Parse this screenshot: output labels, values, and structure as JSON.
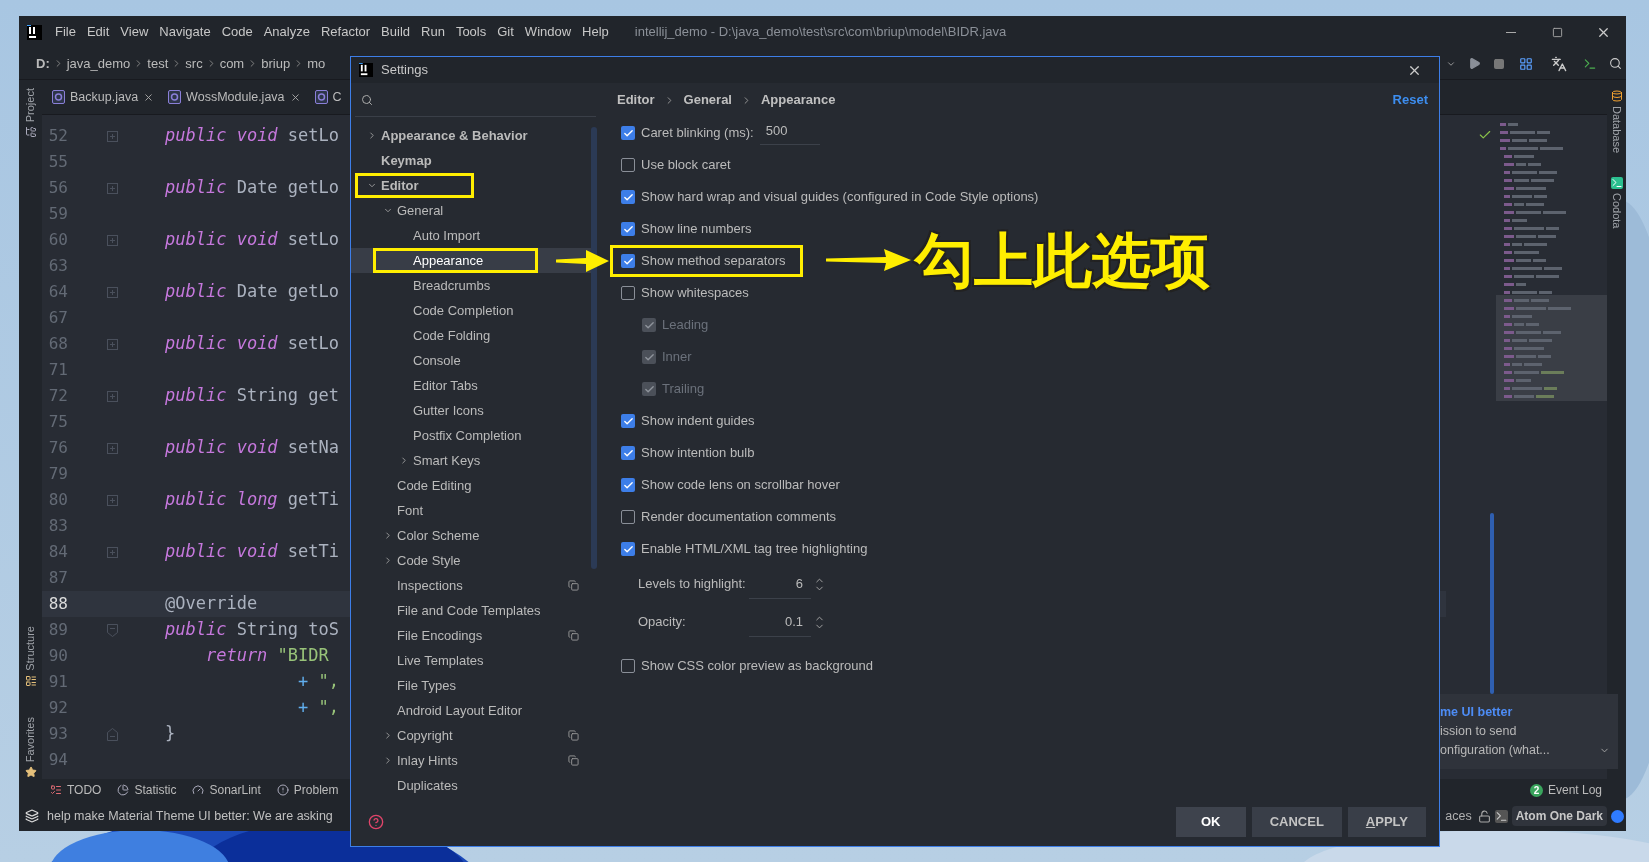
{
  "ide": {
    "title": "intellij_demo - D:\\java_demo\\test\\src\\com\\briup\\model\\BIDR.java",
    "menu": [
      "File",
      "Edit",
      "View",
      "Navigate",
      "Code",
      "Analyze",
      "Refactor",
      "Build",
      "Run",
      "Tools",
      "Git",
      "Window",
      "Help"
    ],
    "breadcrumbs": [
      "D:",
      "java_demo",
      "test",
      "src",
      "com",
      "briup",
      "mo"
    ],
    "tabs": [
      {
        "label": "Backup.java",
        "selected": false,
        "closable": true
      },
      {
        "label": "WossModule.java",
        "selected": false,
        "closable": true
      },
      {
        "label": "C",
        "selected": false,
        "closable": false
      }
    ],
    "left_tools": [
      {
        "label": "Project",
        "kind": "project"
      },
      {
        "label": "Structure",
        "kind": "structure"
      },
      {
        "label": "Favorites",
        "kind": "favorites"
      }
    ],
    "right_tools": [
      {
        "label": "Database",
        "kind": "database"
      },
      {
        "label": "Codota",
        "kind": "codota"
      }
    ],
    "editor": {
      "lines": [
        {
          "number": "52",
          "current": false,
          "fold": {
            "kind": "collapsed"
          },
          "code": [
            {
              "kind": "keyword",
              "text": "public"
            },
            {
              "kind": "keyword",
              "text": " void"
            },
            {
              "kind": "plain",
              "text": " setLo"
            }
          ]
        },
        {
          "number": "55",
          "current": false
        },
        {
          "number": "56",
          "current": false,
          "fold": {
            "kind": "collapsed"
          },
          "code": [
            {
              "kind": "keyword",
              "text": "public"
            },
            {
              "kind": "plain",
              "text": " Date getLo"
            }
          ]
        },
        {
          "number": "59",
          "current": false
        },
        {
          "number": "60",
          "current": false,
          "fold": {
            "kind": "collapsed"
          },
          "code": [
            {
              "kind": "keyword",
              "text": "public"
            },
            {
              "kind": "keyword",
              "text": " void"
            },
            {
              "kind": "plain",
              "text": " setLo"
            }
          ]
        },
        {
          "number": "63",
          "current": false
        },
        {
          "number": "64",
          "current": false,
          "fold": {
            "kind": "collapsed"
          },
          "code": [
            {
              "kind": "keyword",
              "text": "public"
            },
            {
              "kind": "plain",
              "text": " Date getLo"
            }
          ]
        },
        {
          "number": "67",
          "current": false
        },
        {
          "number": "68",
          "current": false,
          "fold": {
            "kind": "collapsed"
          },
          "code": [
            {
              "kind": "keyword",
              "text": "public"
            },
            {
              "kind": "keyword",
              "text": " void"
            },
            {
              "kind": "plain",
              "text": " setLo"
            }
          ]
        },
        {
          "number": "71",
          "current": false
        },
        {
          "number": "72",
          "current": false,
          "fold": {
            "kind": "collapsed"
          },
          "code": [
            {
              "kind": "keyword",
              "text": "public"
            },
            {
              "kind": "plain",
              "text": " String get"
            }
          ]
        },
        {
          "number": "75",
          "current": false
        },
        {
          "number": "76",
          "current": false,
          "fold": {
            "kind": "collapsed"
          },
          "code": [
            {
              "kind": "keyword",
              "text": "public"
            },
            {
              "kind": "keyword",
              "text": " void"
            },
            {
              "kind": "plain",
              "text": " setNa"
            }
          ]
        },
        {
          "number": "79",
          "current": false
        },
        {
          "number": "80",
          "current": false,
          "fold": {
            "kind": "collapsed"
          },
          "code": [
            {
              "kind": "keyword",
              "text": "public"
            },
            {
              "kind": "keyword",
              "text": " long"
            },
            {
              "kind": "plain",
              "text": " getTi"
            }
          ]
        },
        {
          "number": "83",
          "current": false
        },
        {
          "number": "84",
          "current": false,
          "fold": {
            "kind": "collapsed"
          },
          "code": [
            {
              "kind": "keyword",
              "text": "public"
            },
            {
              "kind": "keyword",
              "text": " void"
            },
            {
              "kind": "plain",
              "text": " setTi"
            }
          ]
        },
        {
          "number": "87",
          "current": false
        },
        {
          "number": "88",
          "current": true,
          "code": [
            {
              "kind": "plain",
              "text": "@Override"
            }
          ]
        },
        {
          "number": "89",
          "current": false,
          "fold": {
            "kind": "open"
          },
          "code": [
            {
              "kind": "keyword",
              "text": "public"
            },
            {
              "kind": "plain",
              "text": " String toS"
            }
          ]
        },
        {
          "number": "90",
          "current": false,
          "code": [
            {
              "kind": "keyword",
              "text": "    return"
            },
            {
              "kind": "string",
              "text": " \"BIDR"
            }
          ]
        },
        {
          "number": "91",
          "current": false,
          "code": [
            {
              "kind": "operator",
              "text": "             +"
            },
            {
              "kind": "string",
              "text": " \","
            }
          ]
        },
        {
          "number": "92",
          "current": false,
          "code": [
            {
              "kind": "operator",
              "text": "             +"
            },
            {
              "kind": "string",
              "text": " \","
            }
          ]
        },
        {
          "number": "93",
          "current": false,
          "fold": {
            "kind": "end"
          },
          "code": [
            {
              "kind": "plain",
              "text": "}"
            }
          ]
        },
        {
          "number": "94",
          "current": false
        }
      ]
    },
    "bottom_tools": [
      {
        "label": "TODO",
        "kind": "todo"
      },
      {
        "label": "Statistic",
        "kind": "statistic"
      },
      {
        "label": "SonarLint",
        "kind": "sonar"
      },
      {
        "label": "Problem",
        "kind": "problems"
      }
    ],
    "event_log": {
      "count": "2",
      "label": "Event Log"
    },
    "notification": {
      "title": "me UI better",
      "lines": [
        "ission to send",
        "onfiguration (what..."
      ]
    },
    "status": {
      "message": "help make Material Theme UI better: We are asking",
      "indent": "aces",
      "theme": "Atom One Dark"
    }
  },
  "dialog": {
    "title": "Settings",
    "tree": [
      {
        "label": "Appearance & Behavior",
        "expanded": false,
        "selected": false,
        "highlighted": false,
        "scope_icon": false
      },
      {
        "label": "Keymap",
        "selected": false,
        "highlighted": false,
        "scope_icon": false
      },
      {
        "label": "Editor",
        "expanded": true,
        "selected": false,
        "highlighted": true,
        "scope_icon": false,
        "children": [
          {
            "label": "General",
            "expanded": true,
            "selected": false,
            "highlighted": false,
            "scope_icon": false,
            "children": [
              {
                "label": "Auto Import",
                "selected": false,
                "highlighted": false,
                "scope_icon": false
              },
              {
                "label": "Appearance",
                "selected": true,
                "highlighted": true,
                "scope_icon": false
              },
              {
                "label": "Breadcrumbs",
                "selected": false,
                "highlighted": false,
                "scope_icon": false
              },
              {
                "label": "Code Completion",
                "selected": false,
                "highlighted": false,
                "scope_icon": false
              },
              {
                "label": "Code Folding",
                "selected": false,
                "highlighted": false,
                "scope_icon": false
              },
              {
                "label": "Console",
                "selected": false,
                "highlighted": false,
                "scope_icon": false
              },
              {
                "label": "Editor Tabs",
                "selected": false,
                "highlighted": false,
                "scope_icon": false
              },
              {
                "label": "Gutter Icons",
                "selected": false,
                "highlighted": false,
                "scope_icon": false
              },
              {
                "label": "Postfix Completion",
                "selected": false,
                "highlighted": false,
                "scope_icon": false
              },
              {
                "label": "Smart Keys",
                "expanded": false,
                "selected": false,
                "highlighted": false,
                "scope_icon": false
              }
            ]
          },
          {
            "label": "Code Editing",
            "selected": false,
            "highlighted": false,
            "scope_icon": false
          },
          {
            "label": "Font",
            "selected": false,
            "highlighted": false,
            "scope_icon": false
          },
          {
            "label": "Color Scheme",
            "expanded": false,
            "selected": false,
            "highlighted": false,
            "scope_icon": false
          },
          {
            "label": "Code Style",
            "expanded": false,
            "selected": false,
            "highlighted": false,
            "scope_icon": false
          },
          {
            "label": "Inspections",
            "selected": false,
            "highlighted": false,
            "scope_icon": true
          },
          {
            "label": "File and Code Templates",
            "selected": false,
            "highlighted": false,
            "scope_icon": false
          },
          {
            "label": "File Encodings",
            "selected": false,
            "highlighted": false,
            "scope_icon": true
          },
          {
            "label": "Live Templates",
            "selected": false,
            "highlighted": false,
            "scope_icon": false
          },
          {
            "label": "File Types",
            "selected": false,
            "highlighted": false,
            "scope_icon": false
          },
          {
            "label": "Android Layout Editor",
            "selected": false,
            "highlighted": false,
            "scope_icon": false
          },
          {
            "label": "Copyright",
            "expanded": false,
            "selected": false,
            "highlighted": false,
            "scope_icon": true
          },
          {
            "label": "Inlay Hints",
            "expanded": false,
            "selected": false,
            "highlighted": false,
            "scope_icon": true
          },
          {
            "label": "Duplicates",
            "selected": false,
            "highlighted": false,
            "scope_icon": false
          }
        ]
      }
    ],
    "breadcrumb": [
      "Editor",
      "General",
      "Appearance"
    ],
    "reset": "Reset",
    "options": [
      {
        "kind": "checkbox",
        "label": "Caret blinking (ms):",
        "value": "500",
        "checked": true,
        "disabled": false,
        "highlighted": false
      },
      {
        "kind": "checkbox",
        "label": "Use block caret",
        "checked": false,
        "disabled": false,
        "highlighted": false
      },
      {
        "kind": "checkbox",
        "label": "Show hard wrap and visual guides (configured in Code Style options)",
        "checked": true,
        "disabled": false,
        "highlighted": false
      },
      {
        "kind": "checkbox",
        "label": "Show line numbers",
        "checked": true,
        "disabled": false,
        "highlighted": false
      },
      {
        "kind": "checkbox",
        "label": "Show method separators",
        "checked": true,
        "disabled": false,
        "highlighted": true
      },
      {
        "kind": "checkbox",
        "label": "Show whitespaces",
        "checked": false,
        "disabled": false,
        "highlighted": false,
        "children": [
          {
            "kind": "checkbox",
            "label": "Leading",
            "checked": true,
            "disabled": true,
            "highlighted": false
          },
          {
            "kind": "checkbox",
            "label": "Inner",
            "checked": true,
            "disabled": true,
            "highlighted": false
          },
          {
            "kind": "checkbox",
            "label": "Trailing",
            "checked": true,
            "disabled": true,
            "highlighted": false
          }
        ]
      },
      {
        "kind": "checkbox",
        "label": "Show indent guides",
        "checked": true,
        "disabled": false,
        "highlighted": false
      },
      {
        "kind": "checkbox",
        "label": "Show intention bulb",
        "checked": true,
        "disabled": false,
        "highlighted": false
      },
      {
        "kind": "checkbox",
        "label": "Show code lens on scrollbar hover",
        "checked": true,
        "disabled": false,
        "highlighted": false
      },
      {
        "kind": "checkbox",
        "label": "Render documentation comments",
        "checked": false,
        "disabled": false,
        "highlighted": false
      },
      {
        "kind": "checkbox",
        "label": "Enable HTML/XML tag tree highlighting",
        "checked": true,
        "disabled": false,
        "highlighted": false
      },
      {
        "kind": "spinner",
        "label": "Levels to highlight:",
        "value": "6"
      },
      {
        "kind": "spinner",
        "label": "Opacity:",
        "value": "0.1"
      },
      {
        "kind": "checkbox",
        "label": "Show CSS color preview as background",
        "checked": false,
        "disabled": false,
        "highlighted": false
      }
    ],
    "buttons": [
      {
        "label": "OK",
        "kind": "default",
        "mnemonic": false
      },
      {
        "label": "CANCEL",
        "kind": "normal",
        "mnemonic": false
      },
      {
        "label": "APPLY",
        "kind": "normal",
        "mnemonic": true
      }
    ]
  },
  "annotation": {
    "text": "勾上此选项"
  }
}
